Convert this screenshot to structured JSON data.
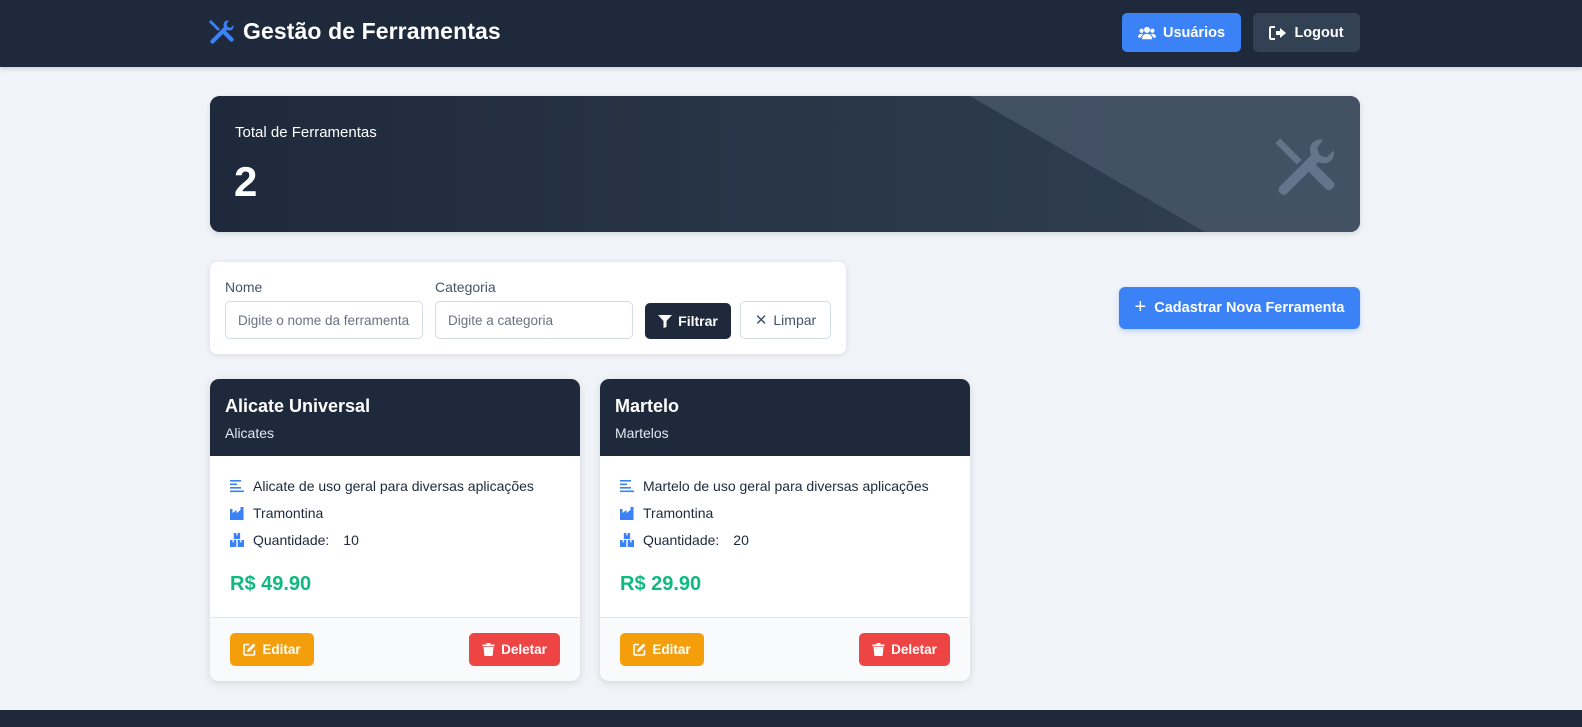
{
  "navbar": {
    "brand_icon": "tools-icon",
    "brand_title": "Gestão de Ferramentas",
    "users_icon": "users-icon",
    "users_label": "Usuários",
    "logout_icon": "logout-icon",
    "logout_label": "Logout"
  },
  "stats": {
    "label": "Total de Ferramentas",
    "value": "2",
    "icon": "tools-icon"
  },
  "filters": {
    "nome_label": "Nome",
    "nome_placeholder": "Digite o nome da ferramenta",
    "nome_value": "",
    "categoria_label": "Categoria",
    "categoria_placeholder": "Digite a categoria",
    "categoria_value": "",
    "filtrar_icon": "filter-icon",
    "filtrar_label": "Filtrar",
    "limpar_icon": "close-icon",
    "limpar_label": "Limpar"
  },
  "new_button": {
    "icon": "plus-icon",
    "label": "Cadastrar Nova Ferramenta"
  },
  "tools": [
    {
      "name": "Alicate Universal",
      "category": "Alicates",
      "description": "Alicate de uso geral para diversas aplicações",
      "manufacturer": "Tramontina",
      "quantity_label": "Quantidade:",
      "quantity": "10",
      "price": "R$ 49.90",
      "edit_label": "Editar",
      "delete_label": "Deletar"
    },
    {
      "name": "Martelo",
      "category": "Martelos",
      "description": "Martelo de uso geral para diversas aplicações",
      "manufacturer": "Tramontina",
      "quantity_label": "Quantidade:",
      "quantity": "20",
      "price": "R$ 29.90",
      "edit_label": "Editar",
      "delete_label": "Deletar"
    }
  ],
  "colors": {
    "navbar": "#1e293b",
    "primary": "#3b82f6",
    "price": "#10b981",
    "edit": "#f59e0b",
    "delete": "#ef4444",
    "background": "#f0f3f8"
  }
}
